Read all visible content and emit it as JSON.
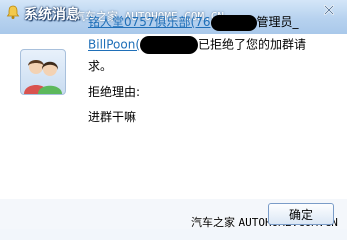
{
  "window": {
    "title": "系统消息",
    "watermark_top": "汽车之家 AUTOHOME.COM.CN",
    "close_icon": "close-icon",
    "title_icon": "bell-icon"
  },
  "message": {
    "group_name": "铭人堂0757俱乐部(76",
    "role_text": "管理员",
    "admin_name": "BillPoon(",
    "rejected_text": "已拒绝了您的加群请",
    "rejected_text_end": "求。",
    "reason_label": "拒绝理由:",
    "reason_value": "进群干嘛"
  },
  "footer": {
    "ok_label": "确定",
    "watermark_cn": "汽车之家",
    "watermark_en": "AUTOHOME.COM.CN"
  },
  "colors": {
    "link": "#1f6fb8",
    "titlebar": "#b7d2ef",
    "redaction": "#000000"
  }
}
